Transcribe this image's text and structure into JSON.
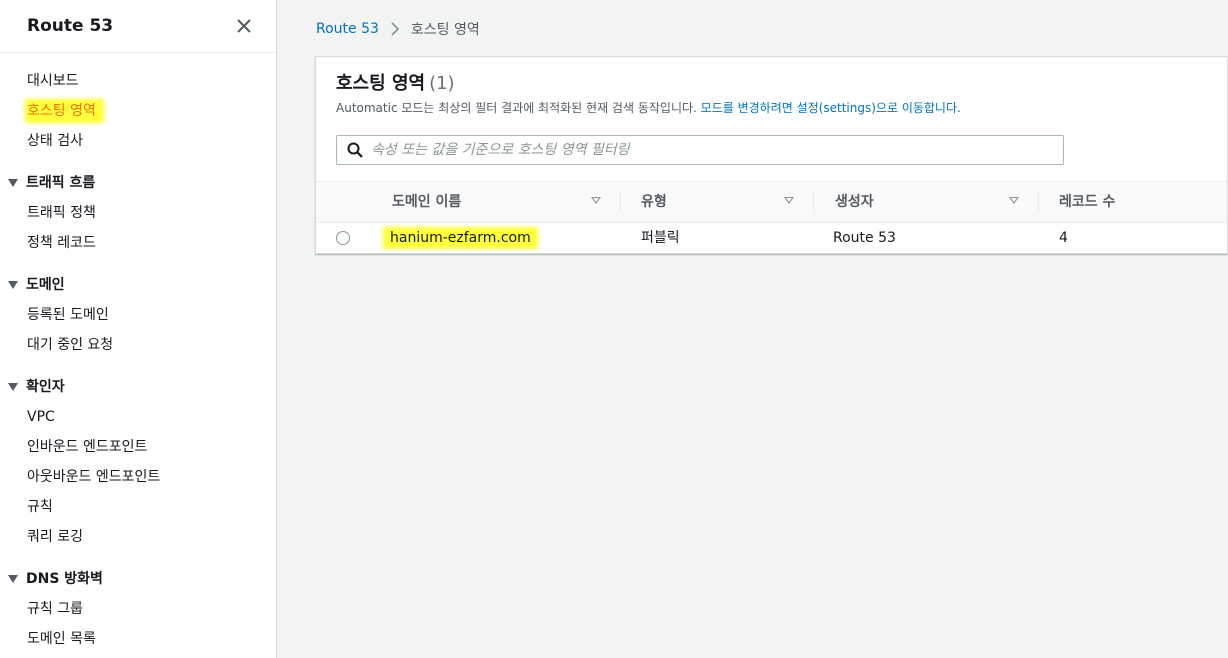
{
  "sidebar": {
    "title": "Route 53",
    "top_items": [
      {
        "label": "대시보드"
      },
      {
        "label": "호스팅 영역"
      },
      {
        "label": "상태 검사"
      }
    ],
    "sections": [
      {
        "title": "트래픽 흐름",
        "items": [
          {
            "label": "트래픽 정책"
          },
          {
            "label": "정책 레코드"
          }
        ]
      },
      {
        "title": "도메인",
        "items": [
          {
            "label": "등록된 도메인"
          },
          {
            "label": "대기 중인 요청"
          }
        ]
      },
      {
        "title": "확인자",
        "items": [
          {
            "label": "VPC"
          },
          {
            "label": "인바운드 엔드포인트"
          },
          {
            "label": "아웃바운드 엔드포인트"
          },
          {
            "label": "규칙"
          },
          {
            "label": "쿼리 로깅"
          }
        ]
      },
      {
        "title": "DNS 방화벽",
        "items": [
          {
            "label": "규칙 그룹"
          },
          {
            "label": "도메인 목록"
          }
        ]
      }
    ]
  },
  "breadcrumb": {
    "root": "Route 53",
    "current": "호스팅 영역"
  },
  "panel": {
    "title": "호스팅 영역",
    "count": "(1)",
    "description": "Automatic 모드는 최상의 필터 결과에 최적화된 현재 검색 동작입니다.",
    "description_link": "모드를 변경하려면 설정(settings)으로 이동합니다.",
    "search_placeholder": "속성 또는 값을 기준으로 호스팅 영역 필터링"
  },
  "table": {
    "columns": [
      "도메인 이름",
      "유형",
      "생성자",
      "레코드 수"
    ],
    "rows": [
      {
        "domain": "hanium-ezfarm.com",
        "type": "퍼블릭",
        "created_by": "Route 53",
        "record_count": "4"
      }
    ]
  },
  "colors": {
    "link": "#0073bb",
    "active_nav": "#ec7211",
    "highlight": "#ffff3a"
  }
}
